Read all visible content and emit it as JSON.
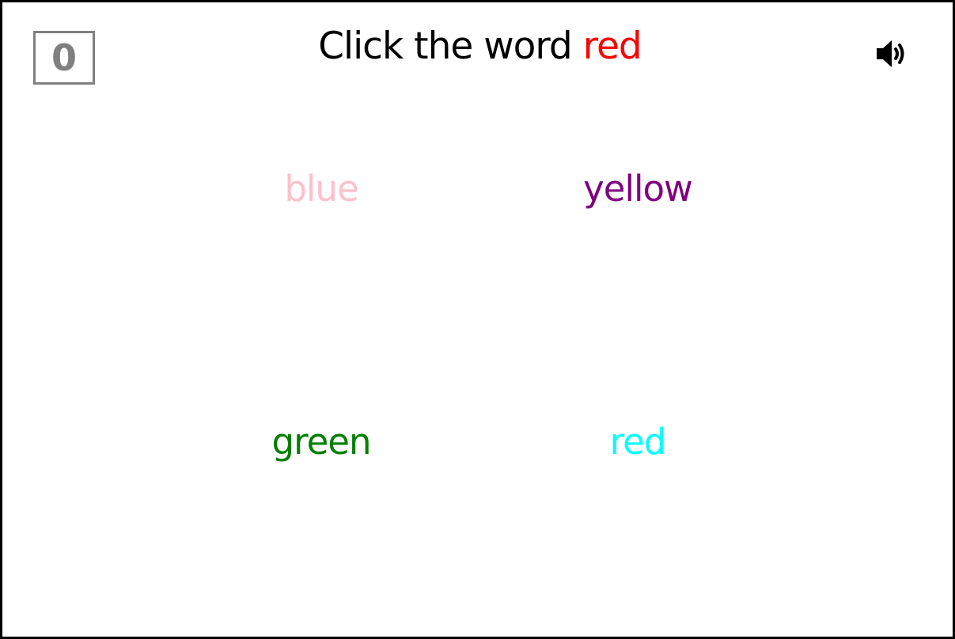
{
  "score": "0",
  "instruction": {
    "prefix": "Click the word",
    "target_word": "red",
    "target_color": "#ff0000"
  },
  "sound": {
    "icon": "speaker-volume-icon"
  },
  "choices": [
    {
      "word": "blue",
      "color": "#ffc0cb"
    },
    {
      "word": "yellow",
      "color": "#800080"
    },
    {
      "word": "green",
      "color": "#008000"
    },
    {
      "word": "red",
      "color": "#00ffff"
    }
  ]
}
